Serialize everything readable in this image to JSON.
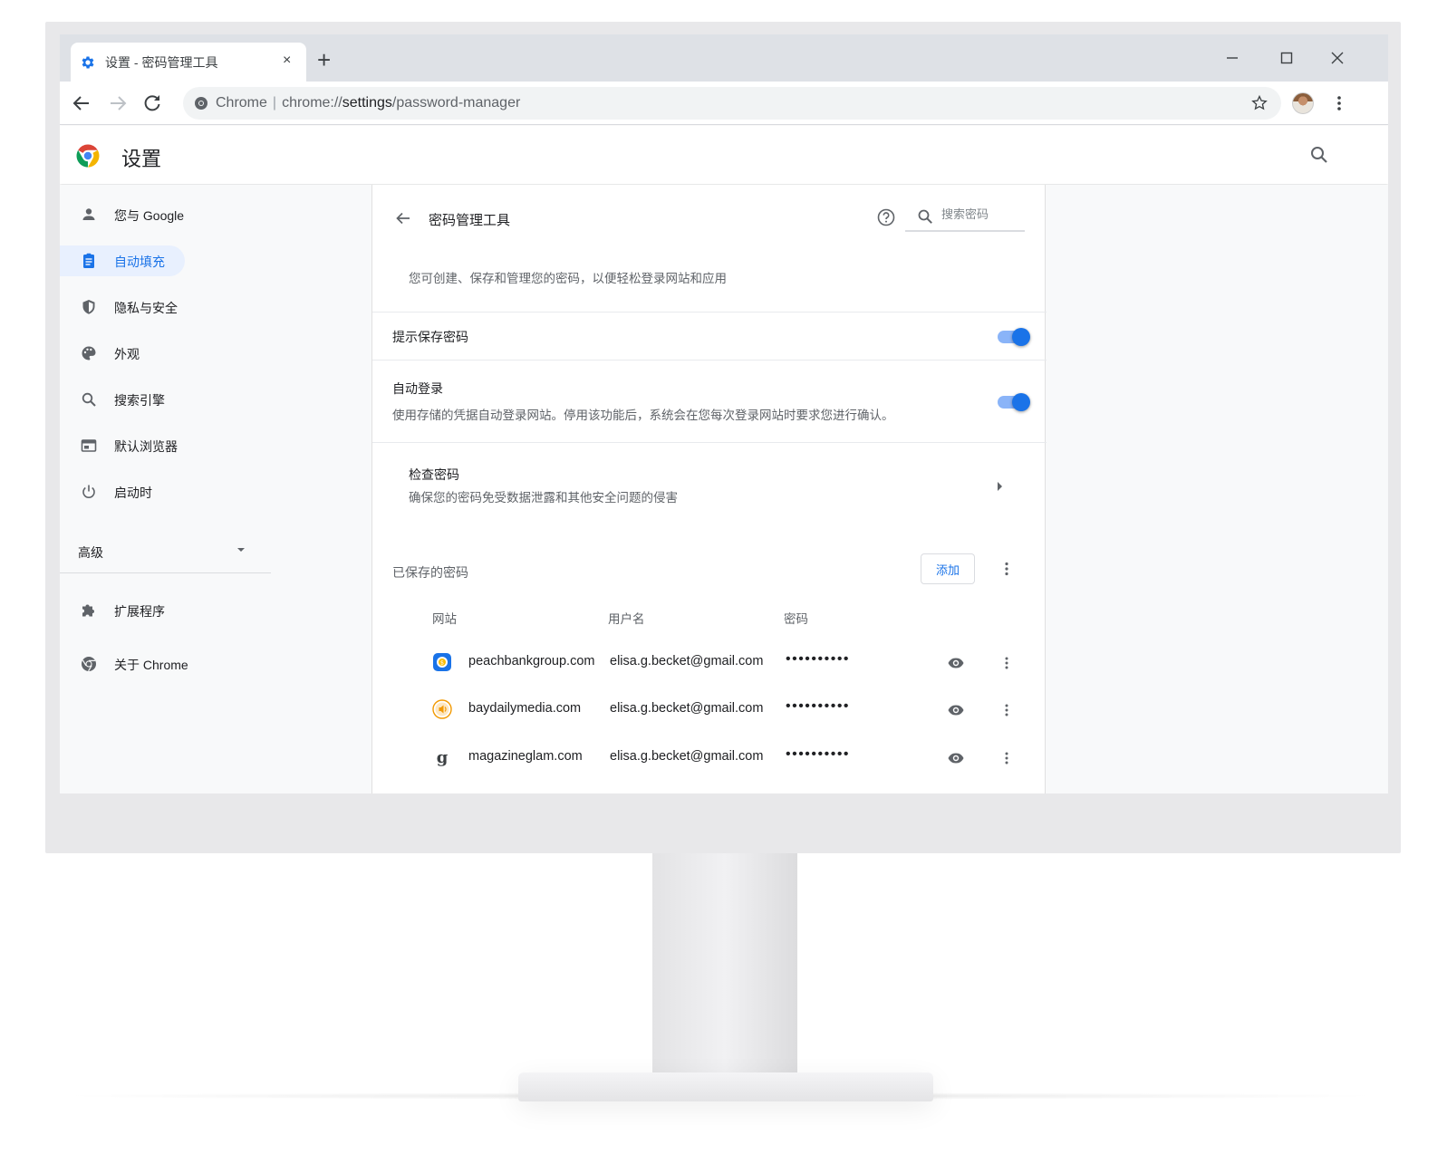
{
  "browser": {
    "tab_title": "设置 - 密码管理工具",
    "new_tab_symbol": "+",
    "close_tab_symbol": "×",
    "address_prefix": "Chrome",
    "address_scheme": "chrome://",
    "address_host": "settings",
    "address_path": "/password-manager"
  },
  "settings": {
    "title": "设置"
  },
  "sidebar": {
    "items": [
      {
        "label": "您与 Google",
        "icon": "person-icon"
      },
      {
        "label": "自动填充",
        "icon": "clipboard-icon",
        "active": true
      },
      {
        "label": "隐私与安全",
        "icon": "shield-icon"
      },
      {
        "label": "外观",
        "icon": "palette-icon"
      },
      {
        "label": "搜索引擎",
        "icon": "search-icon"
      },
      {
        "label": "默认浏览器",
        "icon": "browser-icon"
      },
      {
        "label": "启动时",
        "icon": "power-icon"
      }
    ],
    "advanced_label": "高级",
    "extensions_label": "扩展程序",
    "about_label": "关于 Chrome"
  },
  "page": {
    "title": "密码管理工具",
    "search_placeholder": "搜索密码",
    "intro": "您可创建、保存和管理您的密码，以便轻松登录网站和应用",
    "offer_to_save": {
      "title": "提示保存密码",
      "enabled": true
    },
    "auto_signin": {
      "title": "自动登录",
      "subtitle": "使用存储的凭据自动登录网站。停用该功能后，系统会在您每次登录网站时要求您进行确认。",
      "enabled": true
    },
    "check_passwords": {
      "title": "检查密码",
      "subtitle": "确保您的密码免受数据泄露和其他安全问题的侵害"
    },
    "saved_label": "已保存的密码",
    "add_label": "添加",
    "columns": {
      "site": "网站",
      "username": "用户名",
      "password": "密码"
    },
    "rows": [
      {
        "site": "peachbankgroup.com",
        "username": "elisa.g.becket@gmail.com",
        "password": "••••••••••",
        "icon": "bank-icon"
      },
      {
        "site": "baydailymedia.com",
        "username": "elisa.g.becket@gmail.com",
        "password": "••••••••••",
        "icon": "media-icon"
      },
      {
        "site": "magazineglam.com",
        "username": "elisa.g.becket@gmail.com",
        "password": "••••••••••",
        "icon": "g-letter-icon"
      }
    ]
  },
  "colors": {
    "accent": "#1a73e8",
    "toggle_track": "#8ab4f8",
    "active_nav_bg": "#e8f0fe"
  }
}
